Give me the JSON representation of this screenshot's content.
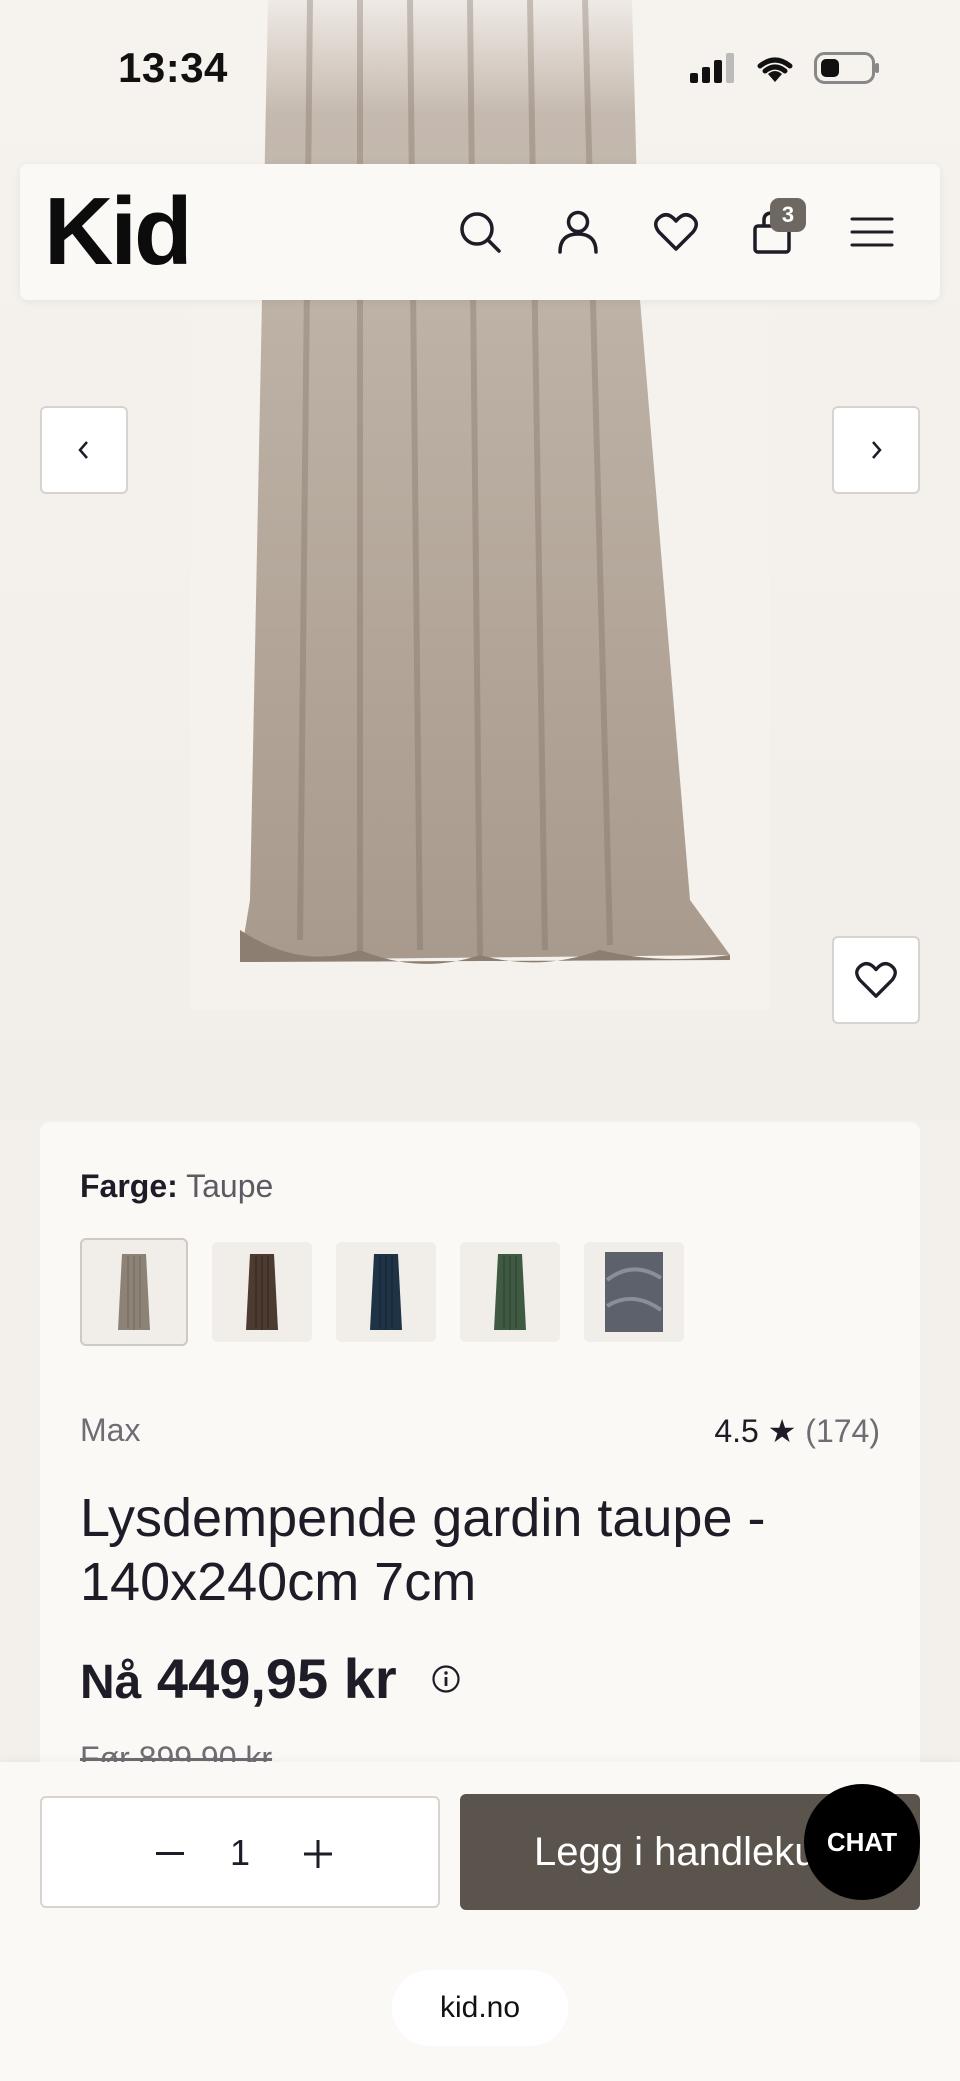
{
  "status_bar": {
    "time": "13:34"
  },
  "header": {
    "logo": "Kid",
    "cart_count": "3"
  },
  "product": {
    "color_label": "Farge:",
    "color_value": "Taupe",
    "swatches": [
      {
        "name": "Taupe",
        "color": "#8d8276"
      },
      {
        "name": "Brown",
        "color": "#4b3b31"
      },
      {
        "name": "Navy",
        "color": "#1f3347"
      },
      {
        "name": "Green",
        "color": "#3f5a43"
      },
      {
        "name": "Grey",
        "color": "#5d616b"
      }
    ],
    "brand": "Max",
    "rating": "4.5",
    "rating_star": "★",
    "review_count": "(174)",
    "title": "Lysdempende gardin taupe - 140x240cm 7cm",
    "price_now_label": "Nå",
    "price_now": "449,95 kr",
    "price_before": "Før 899,90 kr"
  },
  "cart_bar": {
    "quantity": "1",
    "add_to_cart_label": "Legg i handlekurv",
    "chat_label": "CHAT"
  },
  "browser": {
    "url": "kid.no"
  },
  "colors": {
    "accent": "#5b544d",
    "badge": "#6e6862",
    "text": "#1e1c26"
  }
}
